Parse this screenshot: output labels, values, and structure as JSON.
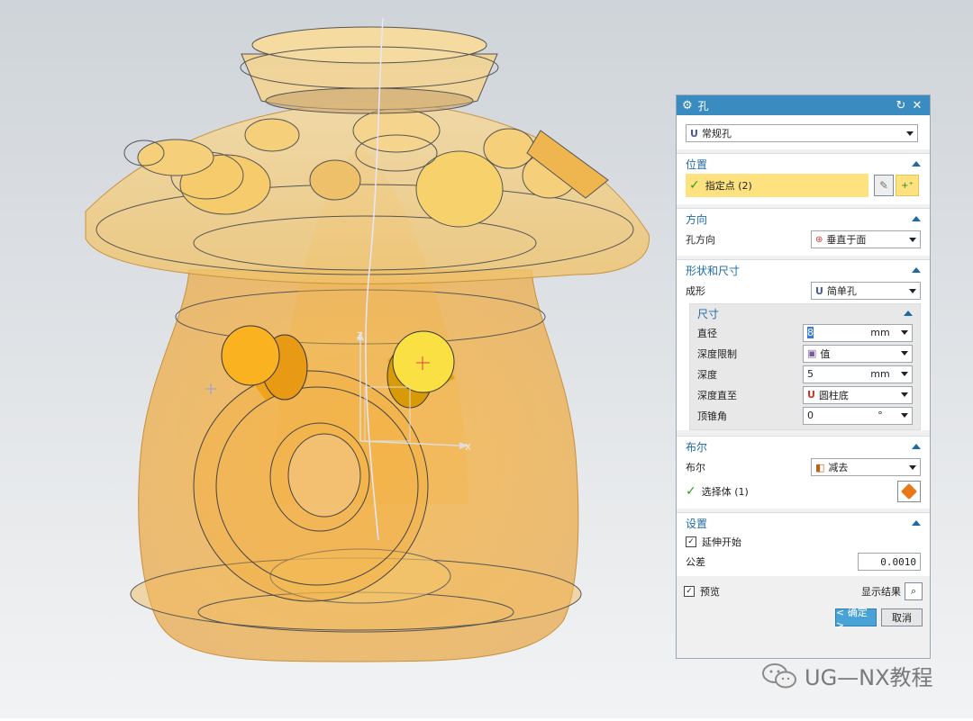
{
  "dialog": {
    "title": "孔",
    "type_value": "常规孔",
    "position": {
      "header": "位置",
      "specify_point": "指定点 (2)"
    },
    "direction": {
      "header": "方向",
      "label": "孔方向",
      "value": "垂直于面"
    },
    "shape": {
      "header": "形状和尺寸",
      "form_label": "成形",
      "form_value": "简单孔",
      "dimensions": {
        "header": "尺寸",
        "diameter_label": "直径",
        "diameter_value": "8",
        "diameter_unit": "mm",
        "depth_limit_label": "深度限制",
        "depth_limit_value": "值",
        "depth_label": "深度",
        "depth_value": "5",
        "depth_unit": "mm",
        "depth_to_label": "深度直至",
        "depth_to_value": "圆柱底",
        "tip_angle_label": "顶锥角",
        "tip_angle_value": "0",
        "tip_angle_unit": "°"
      }
    },
    "boolean": {
      "header": "布尔",
      "label": "布尔",
      "value": "减去",
      "select_body": "选择体 (1)"
    },
    "settings": {
      "header": "设置",
      "extend_start": "延伸开始",
      "tolerance_label": "公差",
      "tolerance_value": "0.0010"
    },
    "preview_label": "预览",
    "show_result_label": "显示结果",
    "ok_label": "< 确定 >",
    "cancel_label": "取消"
  },
  "viewport": {
    "axis_x": "X",
    "axis_z": "Z"
  },
  "watermark": "UG—NX教程",
  "colors": {
    "accent": "#3a8cc0",
    "selection": "#fde27f",
    "model": "#f5b642"
  }
}
